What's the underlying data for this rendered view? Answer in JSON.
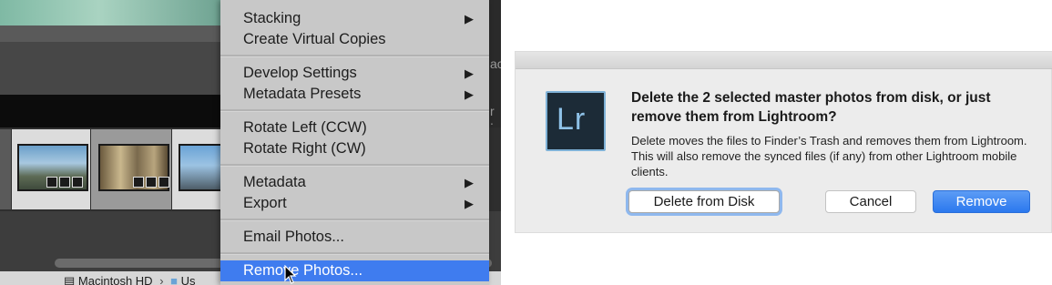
{
  "context_menu": {
    "items": [
      {
        "label": "Stacking",
        "submenu": true
      },
      {
        "label": "Create Virtual Copies",
        "submenu": false
      },
      {
        "label": "Develop Settings",
        "submenu": true
      },
      {
        "label": "Metadata Presets",
        "submenu": true
      },
      {
        "label": "Rotate Left (CCW)",
        "submenu": false
      },
      {
        "label": "Rotate Right (CW)",
        "submenu": false
      },
      {
        "label": "Metadata",
        "submenu": true
      },
      {
        "label": "Export",
        "submenu": true
      },
      {
        "label": "Email Photos...",
        "submenu": false
      },
      {
        "label": "Remove Photos...",
        "submenu": false,
        "highlighted": true
      }
    ],
    "submenu_arrow": "▶"
  },
  "pathbar": {
    "disk": "Macintosh HD",
    "next": "Us"
  },
  "right_edge_glyphs": [
    "ac",
    "r :"
  ],
  "dialog": {
    "app_icon_label": "Lr",
    "headline": "Delete the 2 selected master photos from disk, or just remove them from Lightroom?",
    "body": "Delete moves the files to Finder’s Trash and removes them from Lightroom.  This will also remove the synced files (if any) from other Lightroom mobile clients.",
    "buttons": {
      "delete_from_disk": "Delete from Disk",
      "cancel": "Cancel",
      "remove": "Remove"
    }
  },
  "colors": {
    "menu_highlight": "#3f7cef",
    "primary_button": "#2b78ee",
    "lr_icon_bg": "#1c2b37",
    "lr_icon_fg": "#8ec2e8"
  }
}
